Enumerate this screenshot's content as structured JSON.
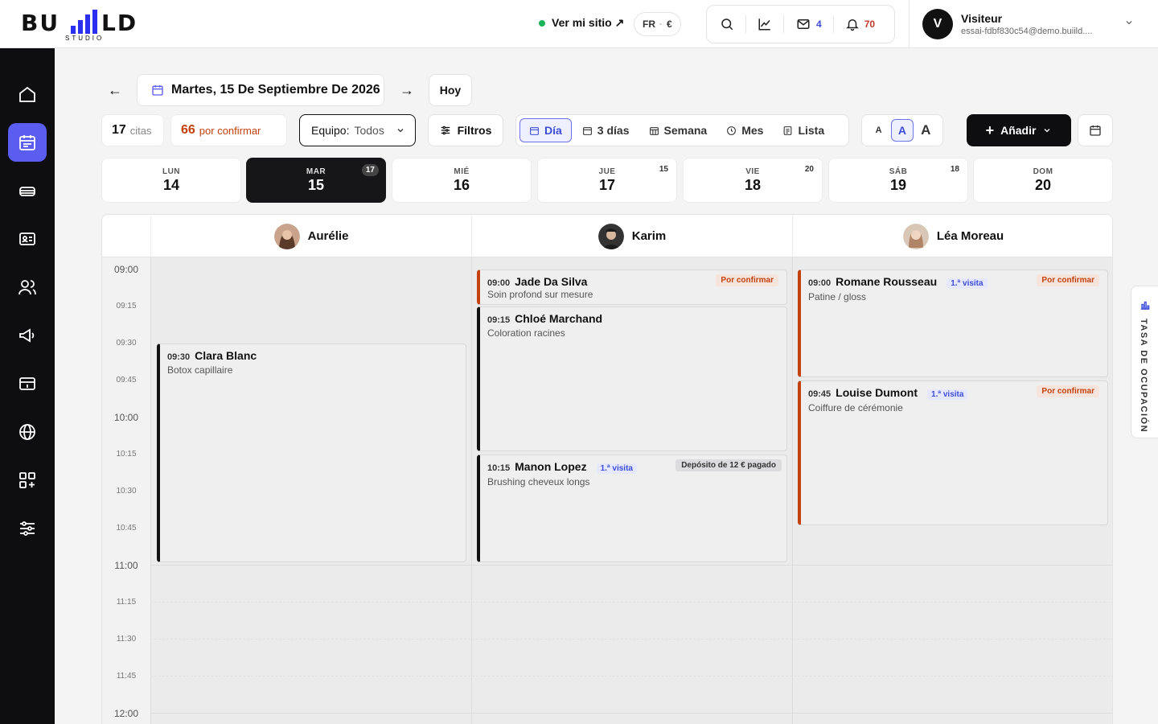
{
  "brand": {
    "logo_left": "BU",
    "logo_right": "LD",
    "logo_sub": "STUDIO"
  },
  "topbar": {
    "site_link": "Ver mi sitio ↗",
    "lang": "FR",
    "currency": "€",
    "messages_count": "4",
    "notifications_count": "70",
    "user_initial": "V",
    "user_name": "Visiteur",
    "user_email": "essai-fdbf830c54@demo.buiild...."
  },
  "header": {
    "prev": "←",
    "next": "→",
    "date": "Martes, 15 De Septiembre De 2026",
    "today": "Hoy"
  },
  "toolbar": {
    "appts_count": "17",
    "appts_label": "citas",
    "pending_count": "66",
    "pending_label": "por confirmar",
    "team_label": "Equipo:",
    "team_value": "Todos",
    "filters": "Filtros",
    "views": [
      "Día",
      "3 días",
      "Semana",
      "Mes",
      "Lista"
    ],
    "font_sizes": [
      "A",
      "A",
      "A"
    ],
    "add": "Añadir"
  },
  "days": [
    {
      "name": "LUN",
      "num": "14",
      "count": ""
    },
    {
      "name": "MAR",
      "num": "15",
      "count": "17"
    },
    {
      "name": "MIÉ",
      "num": "16",
      "count": ""
    },
    {
      "name": "JUE",
      "num": "17",
      "count": "15"
    },
    {
      "name": "VIE",
      "num": "18",
      "count": "20"
    },
    {
      "name": "SÁB",
      "num": "19",
      "count": "18"
    },
    {
      "name": "DOM",
      "num": "20",
      "count": ""
    }
  ],
  "staff": [
    {
      "name": "Aurélie"
    },
    {
      "name": "Karim"
    },
    {
      "name": "Léa Moreau"
    }
  ],
  "times": [
    "09:00",
    "09:15",
    "09:30",
    "09:45",
    "10:00",
    "10:15",
    "10:30",
    "10:45",
    "11:00",
    "11:15",
    "11:30",
    "11:45",
    "12:00"
  ],
  "appointments": [
    {
      "time": "09:30",
      "client": "Clara Blanc",
      "service": "Botox capillaire",
      "first": "",
      "status": ""
    },
    {
      "time": "09:00",
      "client": "Jade Da Silva",
      "service": "Soin profond sur mesure",
      "first": "",
      "status": "Por confirmar"
    },
    {
      "time": "09:15",
      "client": "Chloé Marchand",
      "service": "Coloration racines",
      "first": "",
      "status": ""
    },
    {
      "time": "10:15",
      "client": "Manon Lopez",
      "service": "Brushing cheveux longs",
      "first": "1.ª visita",
      "status": "Depósito de 12 € pagado"
    },
    {
      "time": "09:00",
      "client": "Romane Rousseau",
      "service": "Patine / gloss",
      "first": "1.ª visita",
      "status": "Por confirmar"
    },
    {
      "time": "09:45",
      "client": "Louise Dumont",
      "service": "Coiffure de cérémonie",
      "first": "1.ª visita",
      "status": "Por confirmar"
    }
  ],
  "occupancy_tab": "TASA DE OCUPACIÓN",
  "colors": {
    "accent": "#5b5cf0",
    "pending": "#c2410c",
    "dark": "#0e0e10",
    "first_visit": "#3b4cd8"
  }
}
